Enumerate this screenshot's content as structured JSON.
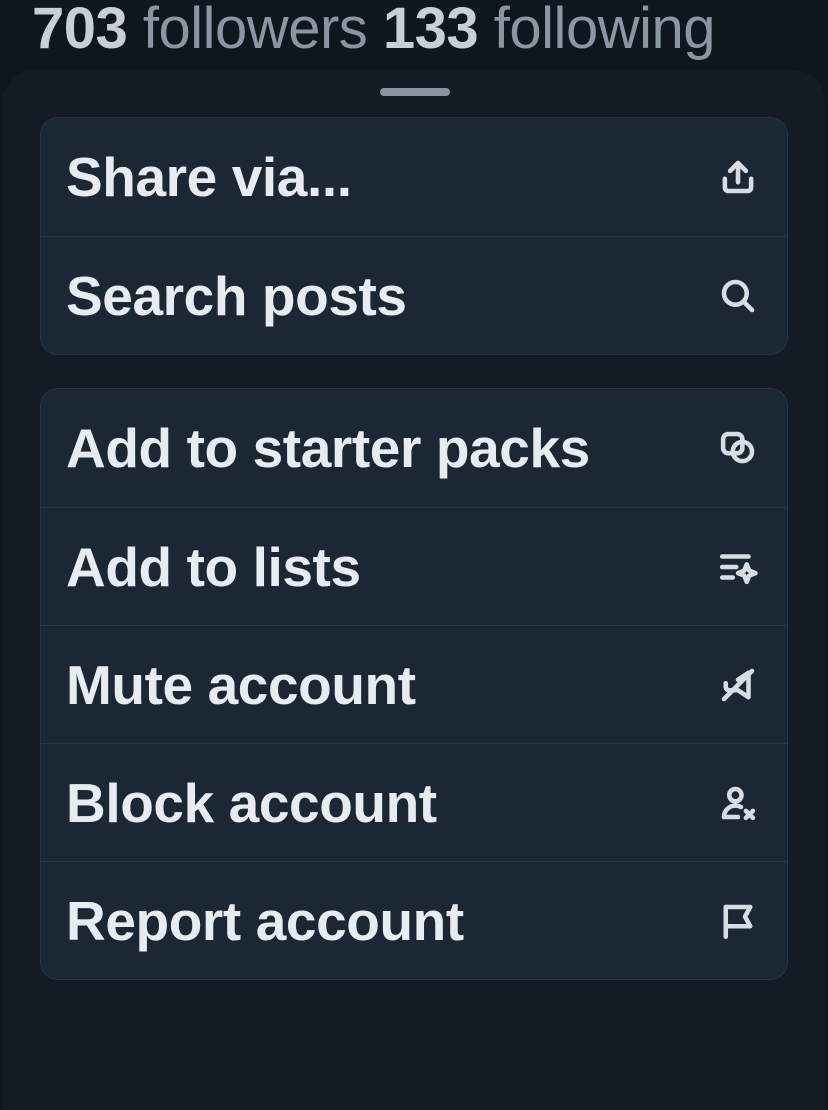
{
  "stats": {
    "followers_count": "703",
    "followers_label": "followers",
    "following_count": "133",
    "following_label": "following"
  },
  "menu": {
    "group_primary": [
      {
        "label": "Share via...",
        "icon": "share-icon"
      },
      {
        "label": "Search posts",
        "icon": "search-icon"
      }
    ],
    "group_actions": [
      {
        "label": "Add to starter packs",
        "icon": "starter-pack-icon"
      },
      {
        "label": "Add to lists",
        "icon": "list-sparkle-icon"
      },
      {
        "label": "Mute account",
        "icon": "mute-icon"
      },
      {
        "label": "Block account",
        "icon": "block-user-icon"
      },
      {
        "label": "Report account",
        "icon": "flag-icon"
      }
    ]
  },
  "colors": {
    "background": "#10161e",
    "sheet": "#141b24",
    "menu_group": "#1c2735",
    "text_primary": "#e8ecf1",
    "text_muted": "#8b95a3"
  }
}
